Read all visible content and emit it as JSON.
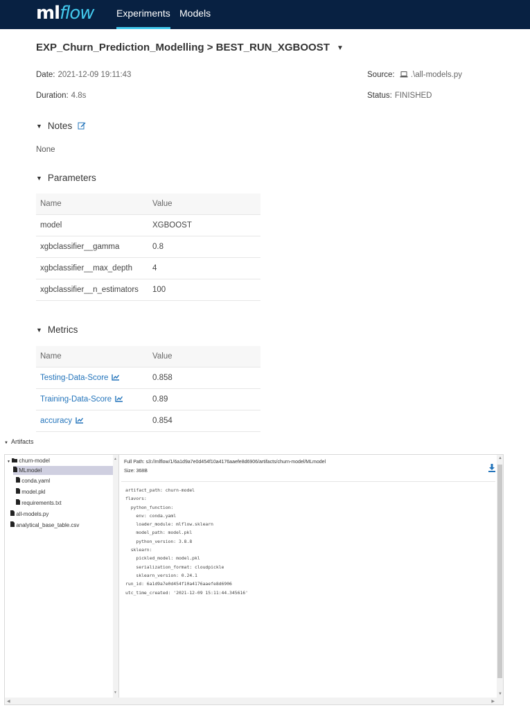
{
  "nav": {
    "logo_ml": "ml",
    "logo_flow": "flow",
    "items": [
      {
        "label": "Experiments",
        "active": true
      },
      {
        "label": "Models",
        "active": false
      }
    ],
    "accent": "#43c9ed",
    "bar_color": "#082142"
  },
  "breadcrumb": {
    "experiment": "EXP_Churn_Prediction_Modelling",
    "separator": ">",
    "run": "BEST_RUN_XGBOOST"
  },
  "run_info": {
    "date_label": "Date:",
    "date_value": "2021-12-09 19:11:43",
    "duration_label": "Duration:",
    "duration_value": "4.8s",
    "source_label": "Source:",
    "source_value": ".\\all-models.py",
    "status_label": "Status:",
    "status_value": "FINISHED"
  },
  "notes": {
    "heading": "Notes",
    "content": "None"
  },
  "parameters": {
    "heading": "Parameters",
    "columns": [
      "Name",
      "Value"
    ],
    "rows": [
      {
        "name": "model",
        "value": "XGBOOST"
      },
      {
        "name": "xgbclassifier__gamma",
        "value": "0.8"
      },
      {
        "name": "xgbclassifier__max_depth",
        "value": "4"
      },
      {
        "name": "xgbclassifier__n_estimators",
        "value": "100"
      }
    ]
  },
  "metrics": {
    "heading": "Metrics",
    "columns": [
      "Name",
      "Value"
    ],
    "rows": [
      {
        "name": "Testing-Data-Score",
        "value": "0.858"
      },
      {
        "name": "Training-Data-Score",
        "value": "0.89"
      },
      {
        "name": "accuracy",
        "value": "0.854"
      }
    ],
    "link_color": "#2374bb"
  },
  "artifacts": {
    "heading": "Artifacts",
    "tree": [
      {
        "label": "churn-model",
        "type": "folder",
        "level": 0,
        "selected": false
      },
      {
        "label": "MLmodel",
        "type": "file",
        "level": 1,
        "selected": true
      },
      {
        "label": "conda.yaml",
        "type": "file",
        "level": 1,
        "selected": false
      },
      {
        "label": "model.pkl",
        "type": "file",
        "level": 1,
        "selected": false
      },
      {
        "label": "requirements.txt",
        "type": "file",
        "level": 1,
        "selected": false
      },
      {
        "label": "all-models.py",
        "type": "file",
        "level": 0,
        "selected": false
      },
      {
        "label": "analytical_base_table.csv",
        "type": "file",
        "level": 0,
        "selected": false
      }
    ],
    "full_path_label": "Full Path:",
    "full_path": "s3://mlflow/1/6a1d9a7e0d454f10a4176aaefe8d6906/artifacts/churn-model/MLmodel",
    "size_label": "Size:",
    "size": "368B",
    "file_content": "artifact_path: churn-model\nflavors:\n  python_function:\n    env: conda.yaml\n    loader_module: mlflow.sklearn\n    model_path: model.pkl\n    python_version: 3.8.8\n  sklearn:\n    pickled_model: model.pkl\n    serialization_format: cloudpickle\n    sklearn_version: 0.24.1\nrun_id: 6a1d9a7e0d454f10a4176aaefe8d6906\nutc_time_created: '2021-12-09 15:11:44.345616'"
  }
}
